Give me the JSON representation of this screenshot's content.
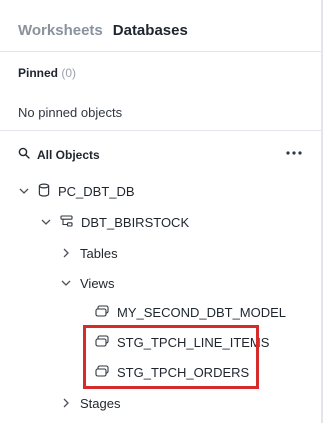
{
  "tabs": [
    {
      "label": "Worksheets",
      "active": false
    },
    {
      "label": "Databases",
      "active": true
    }
  ],
  "pinned": {
    "label": "Pinned",
    "count": "(0)",
    "empty_text": "No pinned objects"
  },
  "objects": {
    "label": "All Objects",
    "more_icon": "ellipsis-icon"
  },
  "tree": {
    "database": {
      "label": "PC_DBT_DB",
      "icon": "database-icon",
      "expanded": true
    },
    "schema": {
      "label": "DBT_BBIRSTOCK",
      "icon": "schema-icon",
      "expanded": true
    },
    "tables": {
      "label": "Tables",
      "expanded": false
    },
    "views": {
      "label": "Views",
      "expanded": true
    },
    "view_items": [
      {
        "label": "MY_SECOND_DBT_MODEL",
        "icon": "view-icon"
      },
      {
        "label": "STG_TPCH_LINE_ITEMS",
        "icon": "view-icon"
      },
      {
        "label": "STG_TPCH_ORDERS",
        "icon": "view-icon"
      }
    ],
    "stages": {
      "label": "Stages",
      "expanded": false
    }
  },
  "colors": {
    "highlight": "#d62b2b",
    "text": "#1e252d",
    "muted": "#8a929c"
  }
}
